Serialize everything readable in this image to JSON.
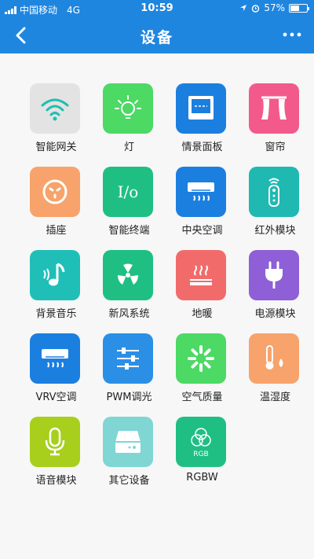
{
  "status": {
    "carrier": "中国移动",
    "network": "4G",
    "time": "10:59",
    "battery": "57%",
    "battery_level": 0.57
  },
  "nav": {
    "title": "设备",
    "back_icon": "chevron-left-icon",
    "more_icon": "more-horizontal-icon"
  },
  "colors": {
    "primary": "#1f86e0",
    "background": "#f7f7f7"
  },
  "devices": [
    {
      "label": "智能网关",
      "icon": "wifi-icon",
      "color": "#e3e3e3"
    },
    {
      "label": "灯",
      "icon": "lightbulb-icon",
      "color": "#4cd964"
    },
    {
      "label": "情景面板",
      "icon": "panel-icon",
      "color": "#1b7fe0"
    },
    {
      "label": "窗帘",
      "icon": "curtain-icon",
      "color": "#f25a8c"
    },
    {
      "label": "插座",
      "icon": "socket-icon",
      "color": "#f7a36b"
    },
    {
      "label": "智能终端",
      "icon": "io-icon",
      "color": "#1fbf84"
    },
    {
      "label": "中央空调",
      "icon": "air-conditioner-icon",
      "color": "#1b7fe0"
    },
    {
      "label": "红外模块",
      "icon": "remote-control-icon",
      "color": "#1fb9b2"
    },
    {
      "label": "背景音乐",
      "icon": "music-icon",
      "color": "#1fbfb8"
    },
    {
      "label": "新风系统",
      "icon": "fan-icon",
      "color": "#1fbf84"
    },
    {
      "label": "地暖",
      "icon": "floor-heating-icon",
      "color": "#f26b6b"
    },
    {
      "label": "电源模块",
      "icon": "plug-icon",
      "color": "#8e5fd6"
    },
    {
      "label": "VRV空调",
      "icon": "vrv-air-conditioner-icon",
      "color": "#1b7fe0"
    },
    {
      "label": "PWM调光",
      "icon": "dimmer-sliders-icon",
      "color": "#2b8fe6"
    },
    {
      "label": "空气质量",
      "icon": "air-quality-icon",
      "color": "#4cd964"
    },
    {
      "label": "温湿度",
      "icon": "thermometer-humidity-icon",
      "color": "#f7a36b"
    },
    {
      "label": "语音模块",
      "icon": "microphone-icon",
      "color": "#a7cf1c"
    },
    {
      "label": "其它设备",
      "icon": "storage-device-icon",
      "color": "#7fd6d3"
    },
    {
      "label": "RGBW",
      "icon": "rgb-icon",
      "color": "#1fbf84",
      "icon_text": "RGB"
    }
  ]
}
